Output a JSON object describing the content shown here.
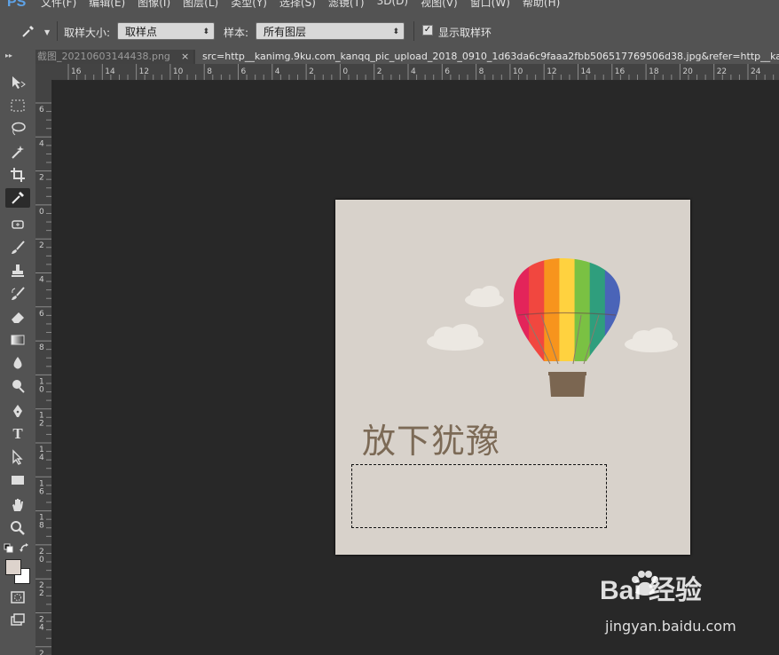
{
  "app": {
    "logo": "PS"
  },
  "menu": [
    "文件(F)",
    "编辑(E)",
    "图像(I)",
    "图层(L)",
    "类型(Y)",
    "选择(S)",
    "滤镜(T)",
    "3D(D)",
    "视图(V)",
    "窗口(W)",
    "帮助(H)"
  ],
  "options": {
    "sample_size_label": "取样大小:",
    "sample_size_value": "取样点",
    "sample_label": "样本:",
    "sample_value": "所有图层",
    "show_ring_label": "显示取样环",
    "show_ring_checked": true
  },
  "tabs": [
    {
      "label": "截图_20210603144438.png",
      "close": "×",
      "active": false
    },
    {
      "label": "src=http__kanimg.9ku.com_kanqq_pic_upload_2018_0910_1d63da6c9faaa2fbb506517769506d38.jpg&refer=http__kan",
      "active": true
    }
  ],
  "ruler_h": [
    "16",
    "14",
    "12",
    "10",
    "8",
    "6",
    "4",
    "2",
    "0",
    "2",
    "4",
    "6",
    "8",
    "10",
    "12",
    "14",
    "16",
    "18",
    "20",
    "22",
    "24"
  ],
  "ruler_v": [
    "6",
    "4",
    "2",
    "0",
    "2",
    "4",
    "6",
    "8",
    "1 0",
    "1 2",
    "1 4",
    "1 6",
    "1 8",
    "2 0",
    "2 2",
    "2 4",
    "2 6"
  ],
  "document": {
    "title_text": "放下犹豫",
    "balloon_colors": [
      "#e3245a",
      "#f1473f",
      "#f7941d",
      "#ffd23f",
      "#7ac143",
      "#2f9e7d",
      "#4a64b8"
    ],
    "basket_color": "#7b6651"
  },
  "colors": {
    "foreground": "#ddd3cc",
    "background": "#ffffff"
  },
  "watermark": {
    "brand": "Bai 经验",
    "url": "jingyan.baidu.com"
  }
}
